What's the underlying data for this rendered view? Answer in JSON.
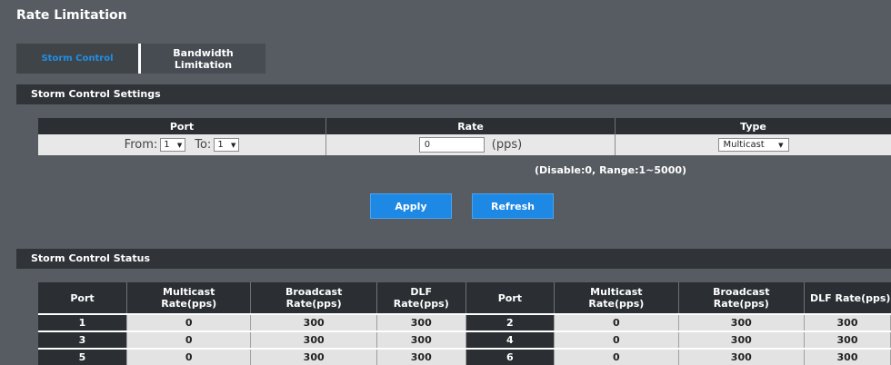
{
  "page": {
    "title": "Rate Limitation"
  },
  "tabs": [
    {
      "label": "Storm Control",
      "active": true
    },
    {
      "label_line1": "Bandwidth",
      "label_line2": "Limitation",
      "active": false
    }
  ],
  "settings": {
    "section_title": "Storm Control Settings",
    "columns": {
      "port": "Port",
      "rate": "Rate",
      "type": "Type"
    },
    "port_from_label": "From:",
    "port_from_value": "1",
    "port_to_label": "To:",
    "port_to_value": "1",
    "rate_value": "0",
    "rate_unit": "(pps)",
    "type_value": "Multicast",
    "hint": "(Disable:0, Range:1~5000)",
    "apply_label": "Apply",
    "refresh_label": "Refresh"
  },
  "status": {
    "section_title": "Storm Control Status",
    "headers": [
      {
        "l1": "Port",
        "l2": ""
      },
      {
        "l1": "Multicast",
        "l2": "Rate(pps)"
      },
      {
        "l1": "Broadcast",
        "l2": "Rate(pps)"
      },
      {
        "l1": "DLF",
        "l2": "Rate(pps)"
      },
      {
        "l1": "Port",
        "l2": ""
      },
      {
        "l1": "Multicast",
        "l2": "Rate(pps)"
      },
      {
        "l1": "Broadcast",
        "l2": "Rate(pps)"
      },
      {
        "l1": "DLF Rate(pps)",
        "l2": ""
      }
    ],
    "rows": [
      [
        "1",
        "0",
        "300",
        "300",
        "2",
        "0",
        "300",
        "300"
      ],
      [
        "3",
        "0",
        "300",
        "300",
        "4",
        "0",
        "300",
        "300"
      ],
      [
        "5",
        "0",
        "300",
        "300",
        "6",
        "0",
        "300",
        "300"
      ]
    ]
  },
  "colors": {
    "accent": "#1e88e5",
    "active_tab_text": "#1f8fe6",
    "page_background": "#575c62",
    "header_background": "#2b2f33"
  }
}
